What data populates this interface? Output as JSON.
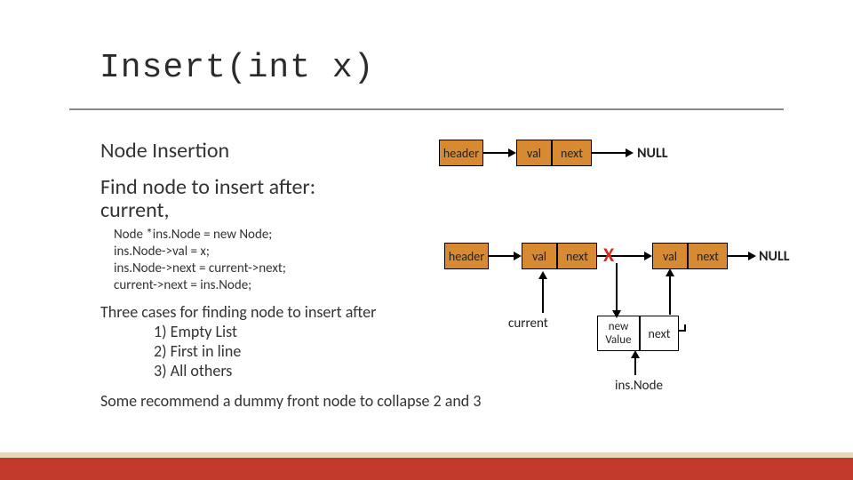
{
  "title": "Insert(int x)",
  "subtitle1": "Node Insertion",
  "subtitle2_line1": "Find node to insert after:",
  "subtitle2_line2": "current,",
  "code": {
    "l1": "Node *ins.Node = new Node;",
    "l2": "ins.Node->val = x;",
    "l3": "ins.Node->next = current->next;",
    "l4": "current->next = ins.Node;"
  },
  "cases_header": "Three cases for finding node to insert after",
  "cases": {
    "c1": "1) Empty List",
    "c2": "2) First in line",
    "c3": "3) All others"
  },
  "recommend": "Some recommend a dummy front node to collapse 2 and 3",
  "diagram": {
    "header": "header",
    "val": "val",
    "next": "next",
    "null": "NULL",
    "current": "current",
    "newValue": "new Value",
    "cross": "X",
    "insNode": "ins.Node"
  }
}
